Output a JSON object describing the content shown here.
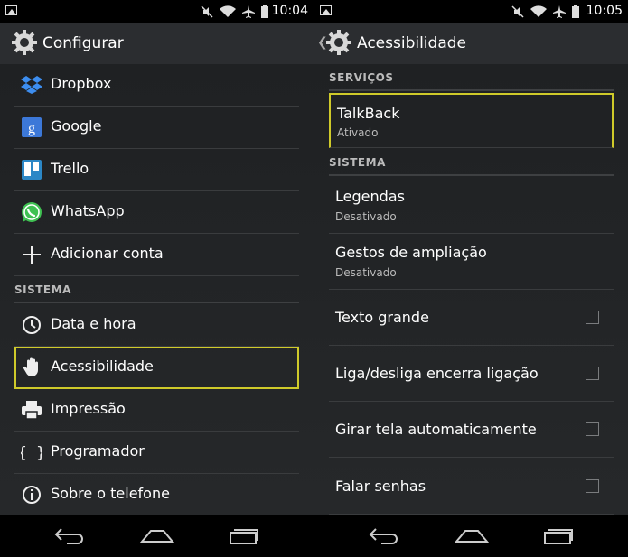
{
  "status_left": {
    "time": "10:04"
  },
  "status_right": {
    "time": "10:05"
  },
  "left": {
    "title": "Configurar",
    "accounts": [
      {
        "label": "Dropbox",
        "icon": "dropbox-icon"
      },
      {
        "label": "Google",
        "icon": "google-icon"
      },
      {
        "label": "Trello",
        "icon": "trello-icon"
      },
      {
        "label": "WhatsApp",
        "icon": "whatsapp-icon"
      },
      {
        "label": "Adicionar conta",
        "icon": "plus-icon"
      }
    ],
    "section_sistema": "SISTEMA",
    "system_items": [
      {
        "label": "Data e hora",
        "icon": "clock-icon"
      },
      {
        "label": "Acessibilidade",
        "icon": "hand-icon"
      },
      {
        "label": "Impressão",
        "icon": "printer-icon"
      },
      {
        "label": "Programador",
        "icon": "braces-icon"
      },
      {
        "label": "Sobre o telefone",
        "icon": "info-icon"
      }
    ]
  },
  "right": {
    "title": "Acessibilidade",
    "section_servicos": "SERVIÇOS",
    "talkback": {
      "label": "TalkBack",
      "status": "Ativado"
    },
    "section_sistema": "SISTEMA",
    "legendas": {
      "label": "Legendas",
      "status": "Desativado"
    },
    "gestos": {
      "label": "Gestos de ampliação",
      "status": "Desativado"
    },
    "toggles": [
      {
        "label": "Texto grande"
      },
      {
        "label": "Liga/desliga encerra ligação"
      },
      {
        "label": "Girar tela automaticamente"
      },
      {
        "label": "Falar senhas"
      }
    ]
  },
  "colors": {
    "focus": "#cfca2a",
    "background": "#1d1f21",
    "whatsapp": "#3fc152",
    "dropbox": "#3d8ef0",
    "google": "#3c78d8"
  }
}
